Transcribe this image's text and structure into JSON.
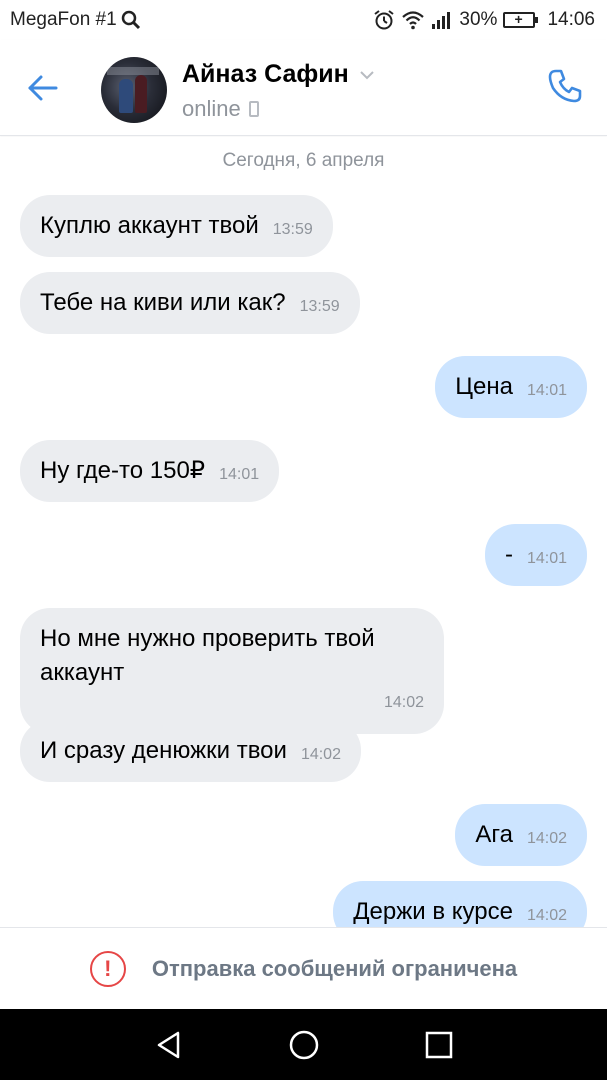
{
  "status_bar": {
    "carrier": "MegaFon #1",
    "battery": "30%",
    "time": "14:06"
  },
  "header": {
    "contact_name": "Айназ Сафин",
    "status": "online"
  },
  "chat": {
    "date_separator": "Сегодня, 6 апреля",
    "messages": [
      {
        "dir": "in",
        "text": "Куплю аккаунт твой",
        "time": "13:59"
      },
      {
        "dir": "in",
        "text": "Тебе на киви или как?",
        "time": "13:59"
      },
      {
        "dir": "out",
        "text": "Цена",
        "time": "14:01"
      },
      {
        "dir": "in",
        "text": "Ну где-то 150₽",
        "time": "14:01"
      },
      {
        "dir": "out",
        "text": "-",
        "time": "14:01"
      },
      {
        "dir": "in",
        "text": "Но мне нужно проверить твой аккаунт",
        "time": "14:02"
      },
      {
        "dir": "in",
        "text": "И сразу денюжки твои",
        "time": "14:02"
      },
      {
        "dir": "out",
        "text": "Ага",
        "time": "14:02"
      },
      {
        "dir": "out",
        "text": "Держи в курсе",
        "time": "14:02"
      }
    ]
  },
  "restriction": {
    "icon": "!",
    "text": "Отправка сообщений ограничена"
  },
  "colors": {
    "accent": "#3f8ae0",
    "incoming_bubble": "#ebedf0",
    "outgoing_bubble": "#cce4ff",
    "warning": "#e64646"
  }
}
